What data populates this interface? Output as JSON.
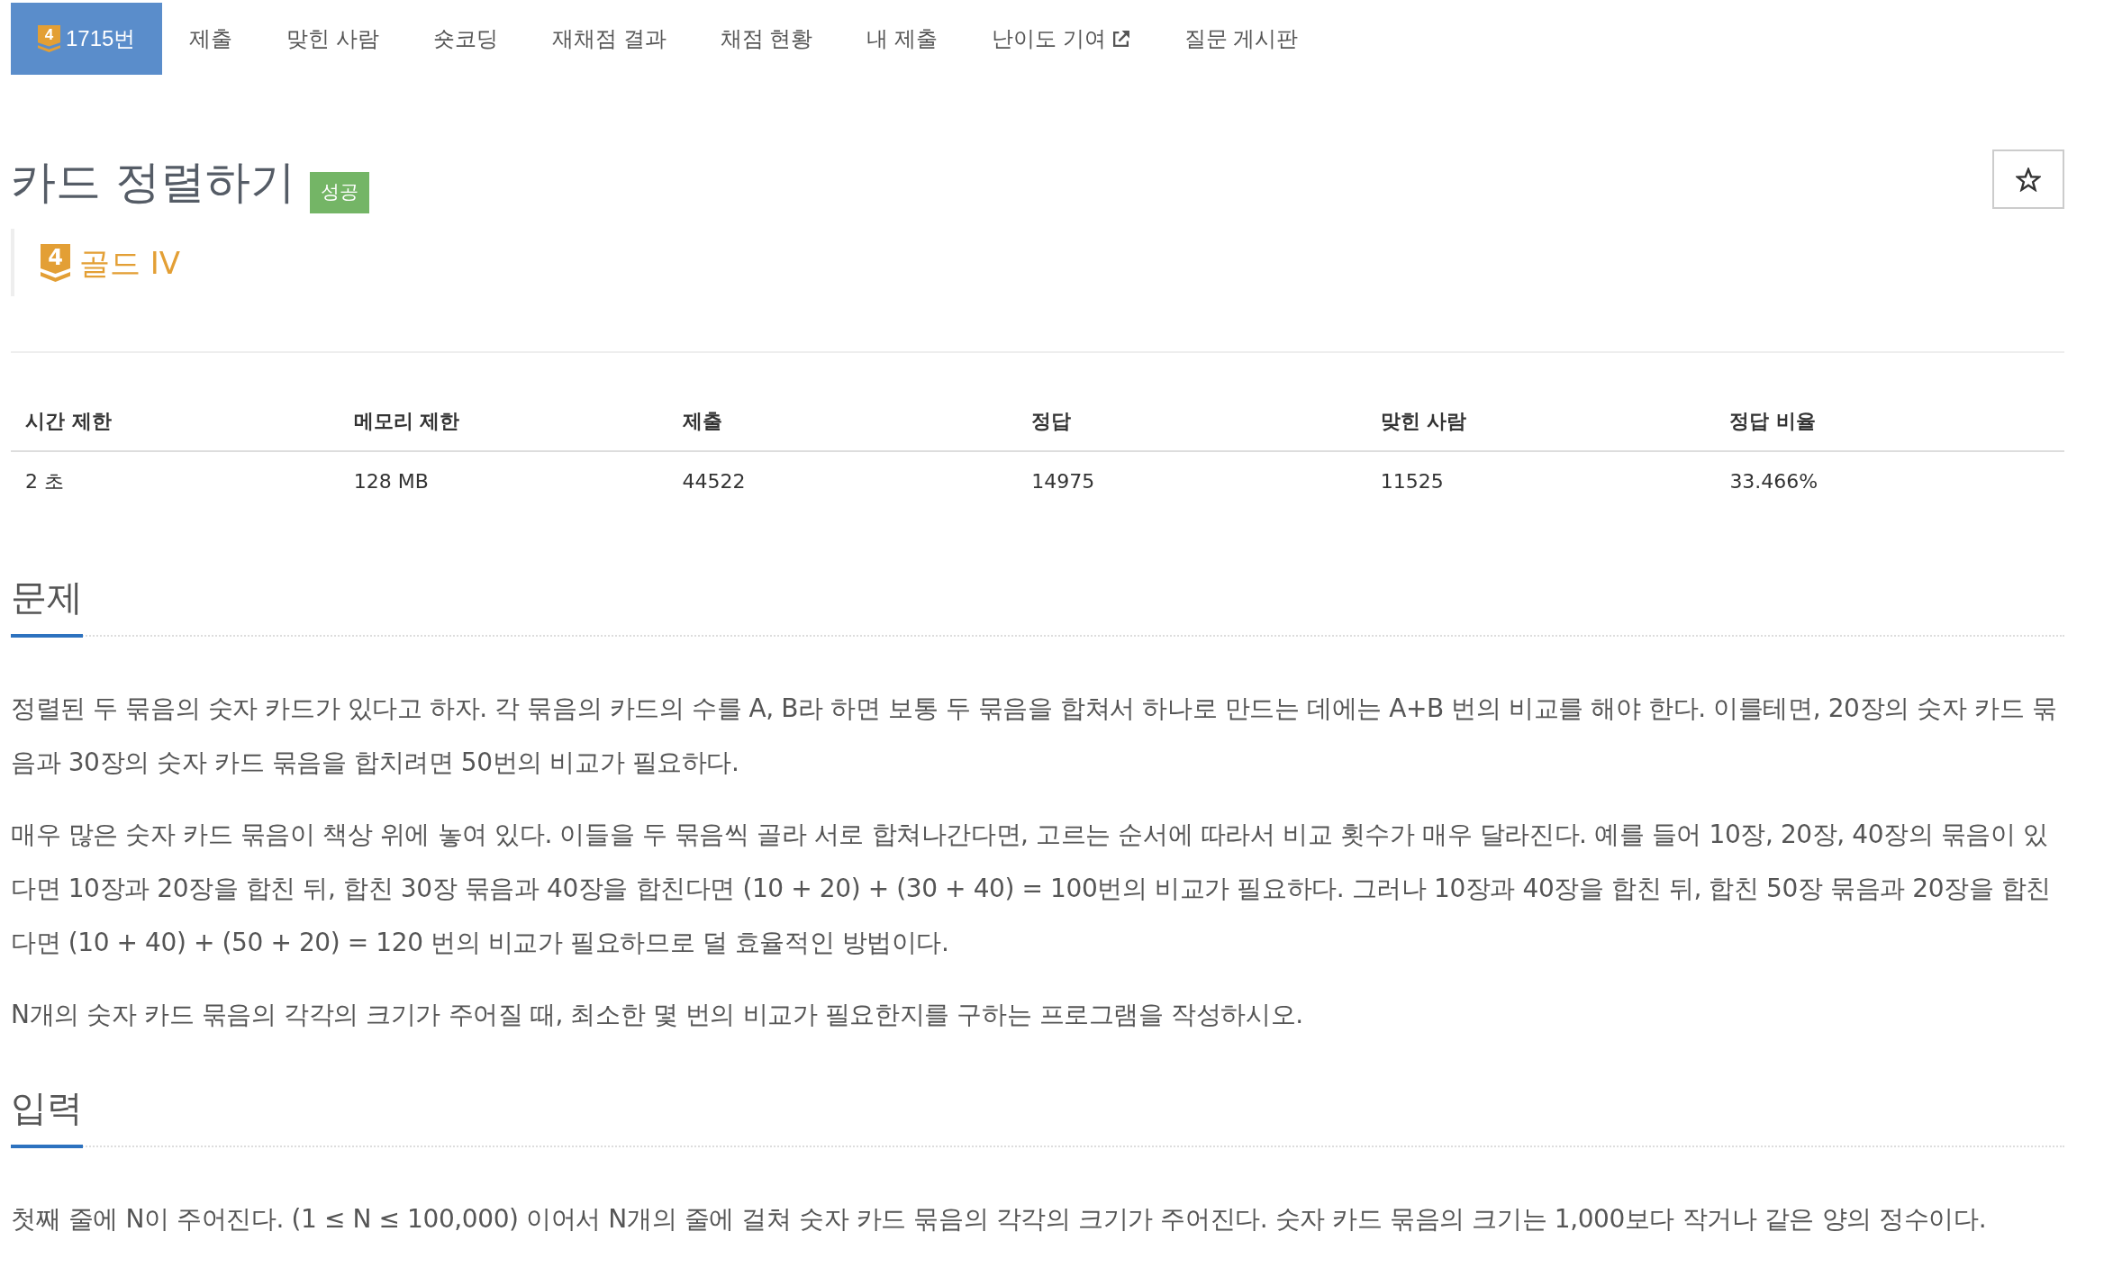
{
  "nav": {
    "tabs": [
      {
        "label": "1715번",
        "selected": true,
        "tier_badge": "4"
      },
      {
        "label": "제출",
        "selected": false
      },
      {
        "label": "맞힌 사람",
        "selected": false
      },
      {
        "label": "숏코딩",
        "selected": false
      },
      {
        "label": "재채점 결과",
        "selected": false
      },
      {
        "label": "채점 현황",
        "selected": false
      },
      {
        "label": "내 제출",
        "selected": false
      },
      {
        "label": "난이도 기여",
        "selected": false,
        "external": true
      },
      {
        "label": "질문 게시판",
        "selected": false
      }
    ]
  },
  "problem": {
    "title": "카드 정렬하기",
    "result_badge": "성공",
    "starred": false,
    "tier": {
      "badge": "4",
      "name": "골드 IV"
    }
  },
  "info_table": {
    "columns": [
      "시간 제한",
      "메모리 제한",
      "제출",
      "정답",
      "맞힌 사람",
      "정답 비율"
    ],
    "rows": [
      [
        "2 초",
        "128 MB",
        "44522",
        "14975",
        "11525",
        "33.466%"
      ]
    ]
  },
  "sections": [
    {
      "heading": "문제",
      "paragraphs": [
        "정렬된 두 묶음의 숫자 카드가 있다고 하자. 각 묶음의 카드의 수를 A, B라 하면 보통 두 묶음을 합쳐서 하나로 만드는 데에는 A+B 번의 비교를 해야 한다. 이를테면, 20장의 숫자 카드 묶음과 30장의 숫자 카드 묶음을 합치려면 50번의 비교가 필요하다.",
        "매우 많은 숫자 카드 묶음이 책상 위에 놓여 있다. 이들을 두 묶음씩 골라 서로 합쳐나간다면, 고르는 순서에 따라서 비교 횟수가 매우 달라진다. 예를 들어 10장, 20장, 40장의 묶음이 있다면 10장과 20장을 합친 뒤, 합친 30장 묶음과 40장을 합친다면 (10 + 20) + (30 + 40) = 100번의 비교가 필요하다. 그러나 10장과 40장을 합친 뒤, 합친 50장 묶음과 20장을 합친다면 (10 + 40) + (50 + 20) = 120 번의 비교가 필요하므로 덜 효율적인 방법이다.",
        "N개의 숫자 카드 묶음의 각각의 크기가 주어질 때, 최소한 몇 번의 비교가 필요한지를 구하는 프로그램을 작성하시오."
      ]
    },
    {
      "heading": "입력",
      "paragraphs": [
        "첫째 줄에 N이 주어진다. (1 ≤ N ≤ 100,000) 이어서 N개의 줄에 걸쳐 숫자 카드 묶음의 각각의 크기가 주어진다. 숫자 카드 묶음의 크기는 1,000보다 작거나 같은 양의 정수이다."
      ]
    }
  ]
}
